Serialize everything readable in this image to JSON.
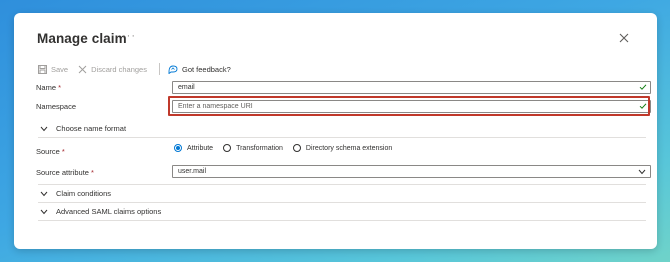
{
  "header": {
    "title": "Manage claim",
    "more": "···"
  },
  "toolbar": {
    "save_label": "Save",
    "discard_label": "Discard changes",
    "feedback_label": "Got feedback?"
  },
  "form": {
    "name_label": "Name",
    "name_value": "email",
    "namespace_label": "Namespace",
    "namespace_placeholder": "Enter a namespace URI",
    "choose_name_format": "Choose name format",
    "source_label": "Source",
    "source_options": [
      "Attribute",
      "Transformation",
      "Directory schema extension"
    ],
    "source_selected": "Attribute",
    "source_attribute_label": "Source attribute",
    "source_attribute_value": "user.mail",
    "claim_conditions": "Claim conditions",
    "advanced_saml": "Advanced SAML claims options",
    "required_marker": "*"
  },
  "colors": {
    "accent": "#0078d4",
    "check": "#107c10",
    "highlight": "#c0392b",
    "required": "#a4262c"
  }
}
